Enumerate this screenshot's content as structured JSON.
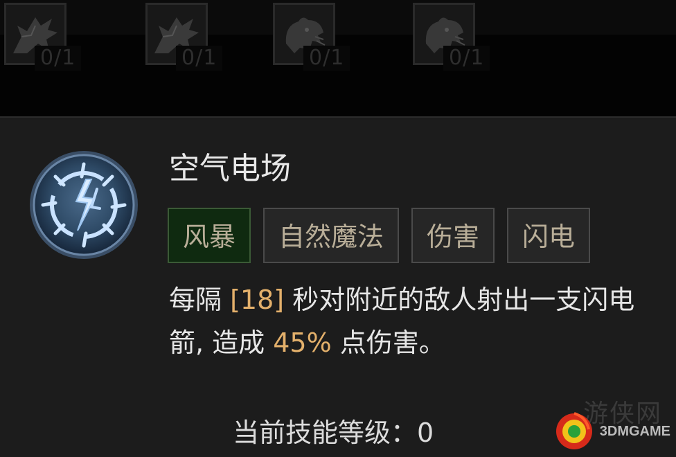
{
  "skill_tree": {
    "slots": [
      {
        "icon": "wolf-icon",
        "count": "0/1"
      },
      {
        "icon": "wolf-icon",
        "count": "0/1"
      },
      {
        "icon": "bear-icon",
        "count": "0/1"
      },
      {
        "icon": "bear-icon",
        "count": "0/1"
      }
    ]
  },
  "tooltip": {
    "icon": "storm-orb-icon",
    "title": "空气电场",
    "tags": [
      "风暴",
      "自然魔法",
      "伤害",
      "闪电"
    ],
    "description": {
      "part1": "每隔 ",
      "cooldown": "[18]",
      "part2": " 秒对附近的敌人射出一支闪电箭, 造成 ",
      "damage": "45%",
      "part3": " 点伤害。"
    },
    "level_label": "当前技能等级：",
    "level_value": "0"
  },
  "watermark": {
    "brand": "3DMGAME",
    "faint": "游侠网"
  },
  "colors": {
    "panel_bg": "#1c1c1c",
    "highlight": "#e3b06b",
    "tag_text": "#b9ae98",
    "active_tag_bg": "#0f2a10"
  }
}
